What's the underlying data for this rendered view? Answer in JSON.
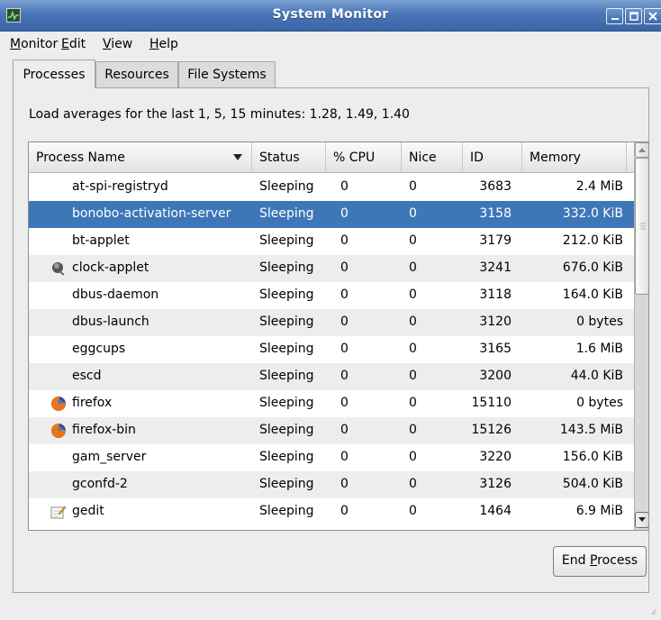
{
  "window": {
    "title": "System Monitor"
  },
  "menubar": {
    "items": [
      {
        "label": "Monitor",
        "mnemonic": "M",
        "rest": "onitor"
      },
      {
        "label": "Edit",
        "mnemonic": "E",
        "rest": "dit"
      },
      {
        "label": "View",
        "mnemonic": "V",
        "rest": "iew"
      },
      {
        "label": "Help",
        "mnemonic": "H",
        "rest": "elp"
      }
    ]
  },
  "tabs": [
    {
      "label": "Processes",
      "active": true
    },
    {
      "label": "Resources",
      "active": false
    },
    {
      "label": "File Systems",
      "active": false
    }
  ],
  "load_averages": "Load averages for the last 1, 5, 15 minutes: 1.28, 1.49, 1.40",
  "table": {
    "columns": [
      "Process Name",
      "Status",
      "% CPU",
      "Nice",
      "ID",
      "Memory"
    ],
    "sorted_by": "Process Name",
    "rows": [
      {
        "name": "at-spi-registryd",
        "status": "Sleeping",
        "cpu": "0",
        "nice": "0",
        "id": "3683",
        "memory": "2.4 MiB",
        "icon": "",
        "selected": false
      },
      {
        "name": "bonobo-activation-server",
        "status": "Sleeping",
        "cpu": "0",
        "nice": "0",
        "id": "3158",
        "memory": "332.0 KiB",
        "icon": "",
        "selected": true
      },
      {
        "name": "bt-applet",
        "status": "Sleeping",
        "cpu": "0",
        "nice": "0",
        "id": "3179",
        "memory": "212.0 KiB",
        "icon": "",
        "selected": false
      },
      {
        "name": "clock-applet",
        "status": "Sleeping",
        "cpu": "0",
        "nice": "0",
        "id": "3241",
        "memory": "676.0 KiB",
        "icon": "clock-applet-icon",
        "selected": false
      },
      {
        "name": "dbus-daemon",
        "status": "Sleeping",
        "cpu": "0",
        "nice": "0",
        "id": "3118",
        "memory": "164.0 KiB",
        "icon": "",
        "selected": false
      },
      {
        "name": "dbus-launch",
        "status": "Sleeping",
        "cpu": "0",
        "nice": "0",
        "id": "3120",
        "memory": "0 bytes",
        "icon": "",
        "selected": false
      },
      {
        "name": "eggcups",
        "status": "Sleeping",
        "cpu": "0",
        "nice": "0",
        "id": "3165",
        "memory": "1.6 MiB",
        "icon": "",
        "selected": false
      },
      {
        "name": "escd",
        "status": "Sleeping",
        "cpu": "0",
        "nice": "0",
        "id": "3200",
        "memory": "44.0 KiB",
        "icon": "",
        "selected": false
      },
      {
        "name": "firefox",
        "status": "Sleeping",
        "cpu": "0",
        "nice": "0",
        "id": "15110",
        "memory": "0 bytes",
        "icon": "firefox-icon",
        "selected": false
      },
      {
        "name": "firefox-bin",
        "status": "Sleeping",
        "cpu": "0",
        "nice": "0",
        "id": "15126",
        "memory": "143.5 MiB",
        "icon": "firefox-icon",
        "selected": false
      },
      {
        "name": "gam_server",
        "status": "Sleeping",
        "cpu": "0",
        "nice": "0",
        "id": "3220",
        "memory": "156.0 KiB",
        "icon": "",
        "selected": false
      },
      {
        "name": "gconfd-2",
        "status": "Sleeping",
        "cpu": "0",
        "nice": "0",
        "id": "3126",
        "memory": "504.0 KiB",
        "icon": "",
        "selected": false
      },
      {
        "name": "gedit",
        "status": "Sleeping",
        "cpu": "0",
        "nice": "0",
        "id": "1464",
        "memory": "6.9 MiB",
        "icon": "gedit-icon",
        "selected": false
      }
    ]
  },
  "end_process_button": {
    "label": "End Process",
    "before": "End ",
    "mnemonic": "P",
    "after": "rocess"
  },
  "colors": {
    "selection": "#3e77b8",
    "titlebar": "#4a76b8"
  }
}
